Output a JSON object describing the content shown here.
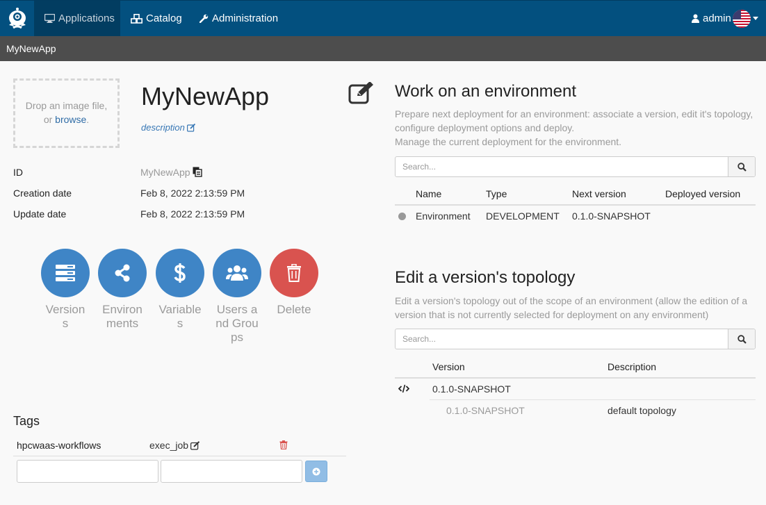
{
  "navbar": {
    "logo_icon": "alien4cloud-logo-icon",
    "items": [
      {
        "label": "Applications",
        "icon": "desktop-icon",
        "active": true
      },
      {
        "label": "Catalog",
        "icon": "cubes-icon",
        "active": false
      },
      {
        "label": "Administration",
        "icon": "wrench-icon",
        "active": false
      }
    ],
    "user": {
      "label": "admin",
      "icon": "user-icon"
    },
    "language_icon": "us-flag-icon"
  },
  "breadcrumb": "MyNewApp",
  "app": {
    "dropzone": {
      "text": "Drop an image file,",
      "or": "or",
      "browse": "browse",
      "dot": "."
    },
    "name": "MyNewApp",
    "description_link": "description",
    "info": [
      {
        "label": "ID",
        "value": "MyNewApp"
      },
      {
        "label": "Creation date",
        "value": "Feb 8, 2022 2:13:59 PM"
      },
      {
        "label": "Update date",
        "value": "Feb 8, 2022 2:13:59 PM"
      }
    ],
    "actions": [
      {
        "label": "Versions",
        "icon": "server-icon"
      },
      {
        "label": "Environments",
        "icon": "share-icon"
      },
      {
        "label": "Variables",
        "icon": "dollar-icon"
      },
      {
        "label": "Users and Groups",
        "icon": "users-icon"
      },
      {
        "label": "Delete",
        "icon": "trash-icon"
      }
    ]
  },
  "tags": {
    "title": "Tags",
    "items": [
      {
        "key": "hpcwaas-workflows",
        "value": "exec_job"
      }
    ],
    "new_key": "",
    "new_value": ""
  },
  "environments": {
    "title": "Work on an environment",
    "help": [
      "Prepare next deployment for an environment: associate a version, edit it's topology,",
      "configure deployment options and deploy.",
      "Manage the current deployment for the environment."
    ],
    "search_placeholder": "Search...",
    "columns": [
      "Name",
      "Type",
      "Next version",
      "Deployed version"
    ],
    "rows": [
      {
        "name": "Environment",
        "type": "DEVELOPMENT",
        "next_version": "0.1.0-SNAPSHOT",
        "deployed_version": ""
      }
    ]
  },
  "topology": {
    "title": "Edit a version's topology",
    "help": [
      "Edit a version's topology out of the scope of an environment (allow the edition of a",
      "version that is not currently selected for deployment on any environment)"
    ],
    "search_placeholder": "Search...",
    "columns": [
      "Version",
      "Description"
    ],
    "rows": [
      {
        "version": "0.1.0-SNAPSHOT",
        "description": ""
      },
      {
        "version": "0.1.0-SNAPSHOT",
        "description": "default topology"
      }
    ]
  },
  "colors": {
    "navbar": "#03507f",
    "action": "#3f85c6",
    "delete": "#d9534f",
    "breadcrumb": "#4d4d4d"
  }
}
